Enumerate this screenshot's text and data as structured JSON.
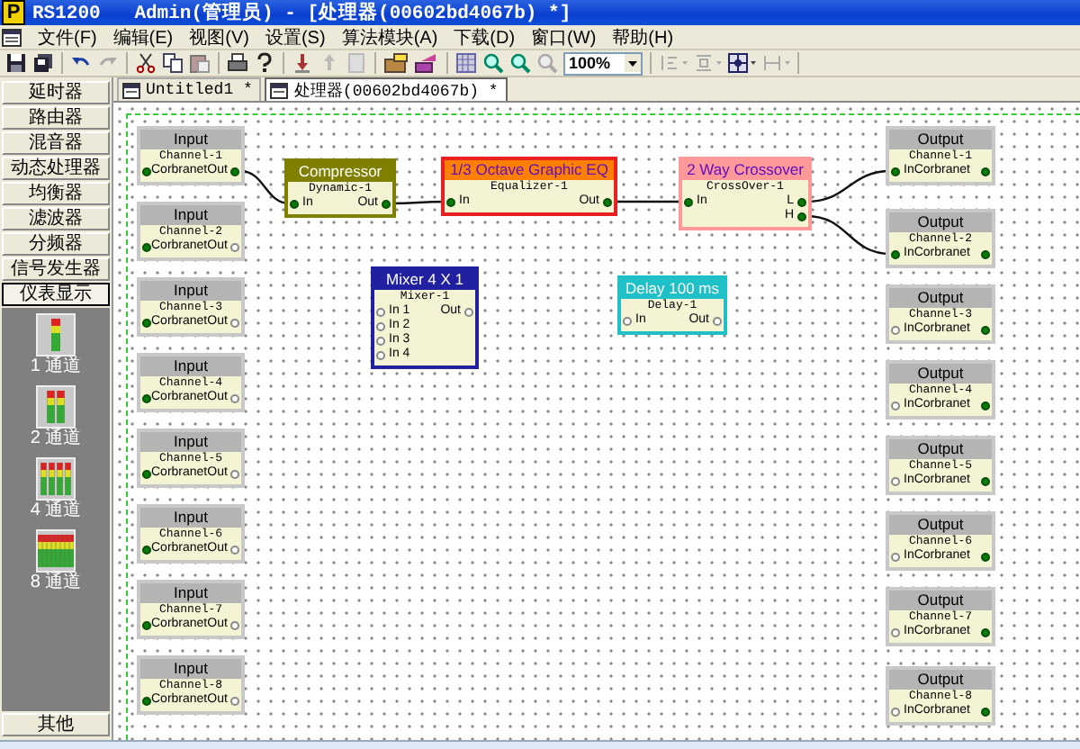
{
  "window": {
    "logo": "P",
    "title": "RS1200   Admin(管理员) - [处理器(00602bd4067b) *]"
  },
  "menu": [
    "文件(F)",
    "编辑(E)",
    "视图(V)",
    "设置(S)",
    "算法模块(A)",
    "下载(D)",
    "窗口(W)",
    "帮助(H)"
  ],
  "toolbar": {
    "zoom": "100%"
  },
  "sidebar": {
    "categories": [
      {
        "label": "延时器",
        "selected": false
      },
      {
        "label": "路由器",
        "selected": false
      },
      {
        "label": "混音器",
        "selected": false
      },
      {
        "label": "动态处理器",
        "selected": false
      },
      {
        "label": "均衡器",
        "selected": false
      },
      {
        "label": "滤波器",
        "selected": false
      },
      {
        "label": "分频器",
        "selected": false
      },
      {
        "label": "信号发生器",
        "selected": false
      },
      {
        "label": "仪表显示",
        "selected": true
      }
    ],
    "meters": [
      {
        "label": "1 通道"
      },
      {
        "label": "2 通道"
      },
      {
        "label": "4 通道"
      },
      {
        "label": "8 通道"
      }
    ],
    "footer": "其他"
  },
  "tabs": [
    {
      "label": "Untitled1 *",
      "selected": false
    },
    {
      "label": "处理器(00602bd4067b) *",
      "selected": true
    }
  ],
  "canvas": {
    "blocks": [
      {
        "kind": "input",
        "title": "Input",
        "name": "Channel-1",
        "color": "#b4b4b4",
        "selected": false,
        "rows": [
          {
            "left": {
              "connected": true
            },
            "right": {
              "label": "CorbranetOut",
              "connected": true
            }
          }
        ]
      },
      {
        "kind": "input",
        "title": "Input",
        "name": "Channel-2",
        "color": "#b4b4b4",
        "selected": false,
        "rows": [
          {
            "left": {
              "connected": true
            },
            "right": {
              "label": "CorbranetOut",
              "connected": false
            }
          }
        ]
      },
      {
        "kind": "input",
        "title": "Input",
        "name": "Channel-3",
        "color": "#b4b4b4",
        "selected": false,
        "rows": [
          {
            "left": {
              "connected": true
            },
            "right": {
              "label": "CorbranetOut",
              "connected": false
            }
          }
        ]
      },
      {
        "kind": "input",
        "title": "Input",
        "name": "Channel-4",
        "color": "#b4b4b4",
        "selected": false,
        "rows": [
          {
            "left": {
              "connected": true
            },
            "right": {
              "label": "CorbranetOut",
              "connected": false
            }
          }
        ]
      },
      {
        "kind": "input",
        "title": "Input",
        "name": "Channel-5",
        "color": "#b4b4b4",
        "selected": false,
        "rows": [
          {
            "left": {
              "connected": true
            },
            "right": {
              "label": "CorbranetOut",
              "connected": false
            }
          }
        ]
      },
      {
        "kind": "input",
        "title": "Input",
        "name": "Channel-6",
        "color": "#b4b4b4",
        "selected": false,
        "rows": [
          {
            "left": {
              "connected": true
            },
            "right": {
              "label": "CorbranetOut",
              "connected": false
            }
          }
        ]
      },
      {
        "kind": "input",
        "title": "Input",
        "name": "Channel-7",
        "color": "#b4b4b4",
        "selected": false,
        "rows": [
          {
            "left": {
              "connected": true
            },
            "right": {
              "label": "CorbranetOut",
              "connected": false
            }
          }
        ]
      },
      {
        "kind": "input",
        "title": "Input",
        "name": "Channel-8",
        "color": "#b4b4b4",
        "selected": false,
        "rows": [
          {
            "left": {
              "connected": true
            },
            "right": {
              "label": "CorbranetOut",
              "connected": false
            }
          }
        ]
      },
      {
        "kind": "processor",
        "title": "Compressor",
        "name": "Dynamic-1",
        "color": "#808000",
        "selected": false,
        "rows": [
          {
            "left": {
              "label": "In",
              "connected": true
            },
            "right": {
              "label": "Out",
              "connected": true
            }
          }
        ]
      },
      {
        "kind": "processor",
        "title": "1/3 Octave Graphic EQ",
        "name": "Equalizer-1",
        "color": "#ff8000",
        "selected": true,
        "rows": [
          {
            "left": {
              "label": "In",
              "connected": true
            },
            "right": {
              "label": "Out",
              "connected": true
            }
          }
        ]
      },
      {
        "kind": "processor",
        "title": "2 Way Crossover",
        "name": "CrossOver-1",
        "color": "#ff9898",
        "selected": false,
        "rows": [
          {
            "left": {
              "label": "In",
              "connected": true
            },
            "right": {
              "label": "L",
              "connected": true
            }
          },
          {
            "right": {
              "label": "H",
              "connected": true
            }
          }
        ]
      },
      {
        "kind": "processor",
        "title": "Mixer 4 X 1",
        "name": "Mixer-1",
        "color": "#2020a0",
        "selected": false,
        "rows": [
          {
            "left": {
              "label": "In 1",
              "connected": false
            },
            "right": {
              "label": "Out",
              "connected": false
            }
          },
          {
            "left": {
              "label": "In 2",
              "connected": false
            }
          },
          {
            "left": {
              "label": "In 3",
              "connected": false
            }
          },
          {
            "left": {
              "label": "In 4",
              "connected": false
            }
          }
        ]
      },
      {
        "kind": "processor",
        "title": "Delay 100 ms",
        "name": "Delay-1",
        "color": "#20c0c8",
        "selected": false,
        "rows": [
          {
            "left": {
              "label": "In",
              "connected": false
            },
            "right": {
              "label": "Out",
              "connected": false
            }
          }
        ]
      },
      {
        "kind": "output",
        "title": "Output",
        "name": "Channel-1",
        "color": "#b4b4b4",
        "selected": false,
        "rows": [
          {
            "left": {
              "label": "InCorbranet",
              "connected": true
            },
            "right": {
              "connected": true
            }
          }
        ]
      },
      {
        "kind": "output",
        "title": "Output",
        "name": "Channel-2",
        "color": "#b4b4b4",
        "selected": false,
        "rows": [
          {
            "left": {
              "label": "InCorbranet",
              "connected": true
            },
            "right": {
              "connected": true
            }
          }
        ]
      },
      {
        "kind": "output",
        "title": "Output",
        "name": "Channel-3",
        "color": "#b4b4b4",
        "selected": false,
        "rows": [
          {
            "left": {
              "label": "InCorbranet",
              "connected": false
            },
            "right": {
              "connected": true
            }
          }
        ]
      },
      {
        "kind": "output",
        "title": "Output",
        "name": "Channel-4",
        "color": "#b4b4b4",
        "selected": false,
        "rows": [
          {
            "left": {
              "label": "InCorbranet",
              "connected": false
            },
            "right": {
              "connected": true
            }
          }
        ]
      },
      {
        "kind": "output",
        "title": "Output",
        "name": "Channel-5",
        "color": "#b4b4b4",
        "selected": false,
        "rows": [
          {
            "left": {
              "label": "InCorbranet",
              "connected": false
            },
            "right": {
              "connected": true
            }
          }
        ]
      },
      {
        "kind": "output",
        "title": "Output",
        "name": "Channel-6",
        "color": "#b4b4b4",
        "selected": false,
        "rows": [
          {
            "left": {
              "label": "InCorbranet",
              "connected": false
            },
            "right": {
              "connected": true
            }
          }
        ]
      },
      {
        "kind": "output",
        "title": "Output",
        "name": "Channel-7",
        "color": "#b4b4b4",
        "selected": false,
        "rows": [
          {
            "left": {
              "label": "InCorbranet",
              "connected": false
            },
            "right": {
              "connected": true
            }
          }
        ]
      },
      {
        "kind": "output",
        "title": "Output",
        "name": "Channel-8",
        "color": "#b4b4b4",
        "selected": false,
        "rows": [
          {
            "left": {
              "label": "InCorbranet",
              "connected": false
            },
            "right": {
              "connected": true
            }
          }
        ]
      }
    ]
  }
}
